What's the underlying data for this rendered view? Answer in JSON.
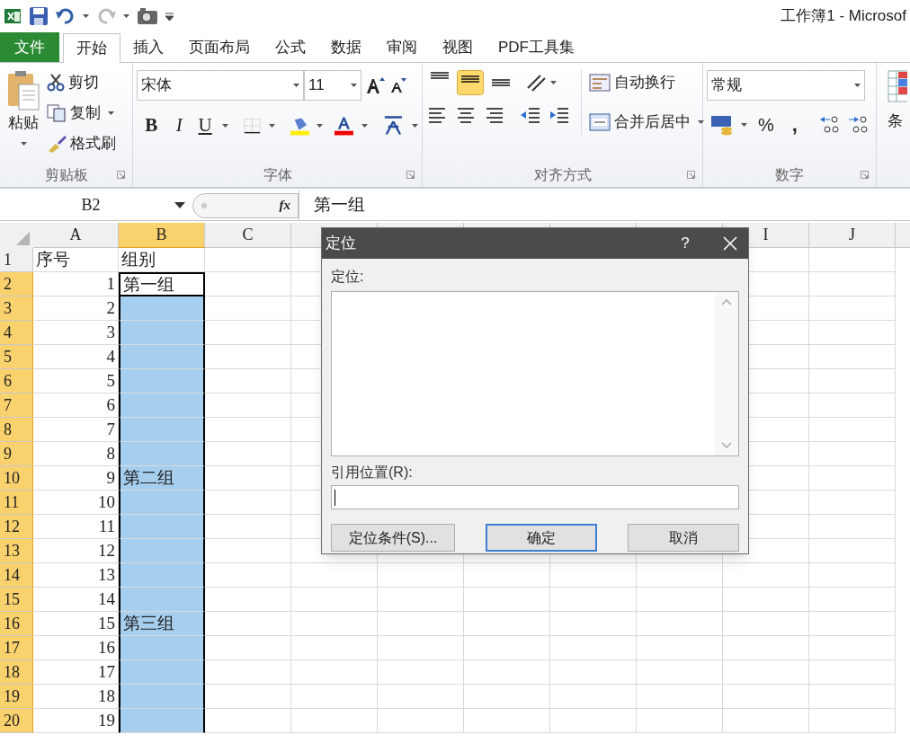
{
  "window": {
    "title": "工作簿1 - Microsof"
  },
  "tabs": [
    {
      "label": "文件",
      "kind": "file",
      "selected": false
    },
    {
      "label": "开始",
      "kind": "tab",
      "selected": true
    },
    {
      "label": "插入",
      "kind": "tab",
      "selected": false
    },
    {
      "label": "页面布局",
      "kind": "tab",
      "selected": false
    },
    {
      "label": "公式",
      "kind": "tab",
      "selected": false
    },
    {
      "label": "数据",
      "kind": "tab",
      "selected": false
    },
    {
      "label": "审阅",
      "kind": "tab",
      "selected": false
    },
    {
      "label": "视图",
      "kind": "tab",
      "selected": false
    },
    {
      "label": "PDF工具集",
      "kind": "tab",
      "selected": false
    }
  ],
  "ribbon": {
    "clipboard": {
      "paste": "粘贴",
      "cut": "剪切",
      "copy": "复制",
      "format_painter": "格式刷",
      "label": "剪贴板"
    },
    "font": {
      "font_name": "宋体",
      "font_size": "11",
      "bold": "B",
      "italic": "I",
      "underline": "U",
      "label": "字体"
    },
    "alignment": {
      "vertical_align": [
        {
          "selected": false
        },
        {
          "selected": true
        },
        {
          "selected": false
        }
      ],
      "wrap_text": "自动换行",
      "merge_center": "合并后居中",
      "label": "对齐方式"
    },
    "number": {
      "format": "常规",
      "percent": "%",
      "comma": ",",
      "label": "数字"
    },
    "styles": {
      "conditional_format": "条"
    }
  },
  "formula_bar": {
    "name_box": "B2",
    "fx": "fx",
    "value": "第一组"
  },
  "sheet": {
    "columns": [
      {
        "label": "A",
        "selected": false
      },
      {
        "label": "B",
        "selected": true
      },
      {
        "label": "C",
        "selected": false
      },
      {
        "selected": false
      },
      {
        "selected": false
      },
      {
        "selected": false
      },
      {
        "selected": false
      },
      {
        "selected": false
      },
      {
        "label": "I",
        "selected": false
      },
      {
        "label": "J",
        "selected": false
      }
    ],
    "rows": [
      {
        "header": "1",
        "selected": false,
        "active": false,
        "a": {
          "text": "序号",
          "kind": "text"
        },
        "b": {
          "text": "组别"
        }
      },
      {
        "header": "2",
        "selected": true,
        "active": true,
        "a": {
          "text": "1",
          "kind": "number"
        },
        "b": {
          "text": "第一组"
        }
      },
      {
        "header": "3",
        "selected": true,
        "active": false,
        "a": {
          "text": "2",
          "kind": "number"
        }
      },
      {
        "header": "4",
        "selected": true,
        "active": false,
        "a": {
          "text": "3",
          "kind": "number"
        }
      },
      {
        "header": "5",
        "selected": true,
        "active": false,
        "a": {
          "text": "4",
          "kind": "number"
        }
      },
      {
        "header": "6",
        "selected": true,
        "active": false,
        "a": {
          "text": "5",
          "kind": "number"
        }
      },
      {
        "header": "7",
        "selected": true,
        "active": false,
        "a": {
          "text": "6",
          "kind": "number"
        }
      },
      {
        "header": "8",
        "selected": true,
        "active": false,
        "a": {
          "text": "7",
          "kind": "number"
        }
      },
      {
        "header": "9",
        "selected": true,
        "active": false,
        "a": {
          "text": "8",
          "kind": "number"
        }
      },
      {
        "header": "10",
        "selected": true,
        "active": false,
        "a": {
          "text": "9",
          "kind": "number"
        },
        "b": {
          "text": "第二组"
        }
      },
      {
        "header": "11",
        "selected": true,
        "active": false,
        "a": {
          "text": "10",
          "kind": "number"
        }
      },
      {
        "header": "12",
        "selected": true,
        "active": false,
        "a": {
          "text": "11",
          "kind": "number"
        }
      },
      {
        "header": "13",
        "selected": true,
        "active": false,
        "a": {
          "text": "12",
          "kind": "number"
        }
      },
      {
        "header": "14",
        "selected": true,
        "active": false,
        "a": {
          "text": "13",
          "kind": "number"
        }
      },
      {
        "header": "15",
        "selected": true,
        "active": false,
        "a": {
          "text": "14",
          "kind": "number"
        }
      },
      {
        "header": "16",
        "selected": true,
        "active": false,
        "a": {
          "text": "15",
          "kind": "number"
        },
        "b": {
          "text": "第三组"
        }
      },
      {
        "header": "17",
        "selected": true,
        "active": false,
        "a": {
          "text": "16",
          "kind": "number"
        }
      },
      {
        "header": "18",
        "selected": true,
        "active": false,
        "a": {
          "text": "17",
          "kind": "number"
        }
      },
      {
        "header": "19",
        "selected": true,
        "active": false,
        "a": {
          "text": "18",
          "kind": "number"
        }
      },
      {
        "header": "20",
        "selected": true,
        "active": false,
        "a": {
          "text": "19",
          "kind": "number"
        }
      }
    ]
  },
  "dialog": {
    "title": "定位",
    "help": "?",
    "list_label": "定位:",
    "reference_label": "引用位置(R):",
    "buttons": [
      {
        "label": "定位条件(S)...",
        "default": false
      },
      {
        "label": "确定",
        "default": true
      },
      {
        "label": "取消",
        "default": false
      }
    ]
  }
}
